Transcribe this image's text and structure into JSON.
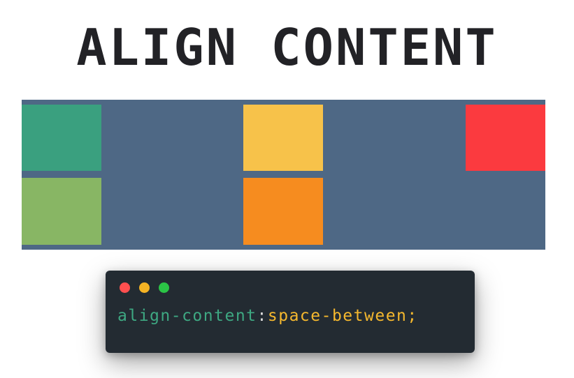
{
  "title": "ALIGN CONTENT",
  "demo": {
    "background_color": "#4e6885",
    "items": [
      {
        "name": "teal-box",
        "color": "#3aa07f",
        "row": 1,
        "column": "start"
      },
      {
        "name": "yellow-box",
        "color": "#f7c24a",
        "row": 1,
        "column": "center"
      },
      {
        "name": "red-box",
        "color": "#fb3a3f",
        "row": 1,
        "column": "end"
      },
      {
        "name": "green-box",
        "color": "#88b664",
        "row": 2,
        "column": "start"
      },
      {
        "name": "orange-box",
        "color": "#f68c1f",
        "row": 2,
        "column": "center"
      }
    ]
  },
  "code": {
    "window_color": "#232b32",
    "property": "align-content",
    "separator": ":",
    "value": "space-between;",
    "property_color": "#3ea882",
    "separator_color": "#d8d8d8",
    "value_color": "#f5b82e",
    "traffic_lights": [
      {
        "name": "close-dot",
        "color": "#ff4f4f"
      },
      {
        "name": "minimize-dot",
        "color": "#f5b324"
      },
      {
        "name": "maximize-dot",
        "color": "#2bc446"
      }
    ]
  }
}
